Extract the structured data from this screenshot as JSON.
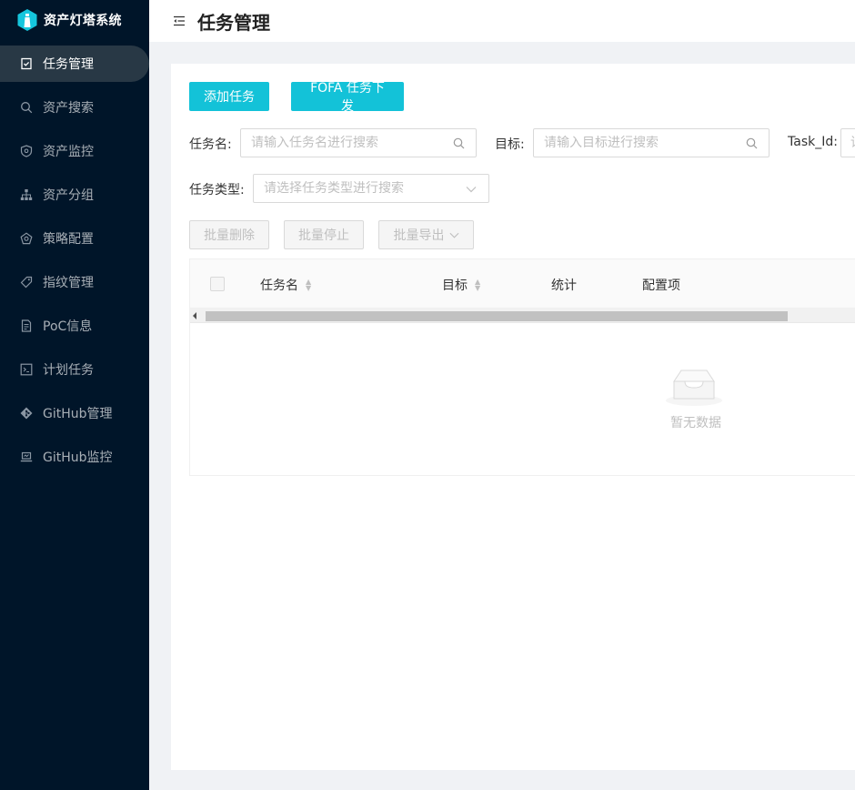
{
  "app": {
    "title": "资产灯塔系统"
  },
  "sidebar": {
    "items": [
      {
        "label": "任务管理",
        "icon": "task-icon",
        "active": true
      },
      {
        "label": "资产搜索",
        "icon": "search-icon"
      },
      {
        "label": "资产监控",
        "icon": "monitor-icon"
      },
      {
        "label": "资产分组",
        "icon": "group-icon"
      },
      {
        "label": "策略配置",
        "icon": "policy-icon"
      },
      {
        "label": "指纹管理",
        "icon": "tag-icon"
      },
      {
        "label": "PoC信息",
        "icon": "file-icon"
      },
      {
        "label": "计划任务",
        "icon": "code-icon"
      },
      {
        "label": "GitHub管理",
        "icon": "github-icon"
      },
      {
        "label": "GitHub监控",
        "icon": "laptop-icon"
      }
    ]
  },
  "header": {
    "title": "任务管理"
  },
  "toolbar": {
    "add_label": "添加任务",
    "fofa_label": "FOFA 任务下发"
  },
  "filters": {
    "task_name_label": "任务名:",
    "task_name_placeholder": "请输入任务名进行搜索",
    "target_label": "目标:",
    "target_placeholder": "请输入目标进行搜索",
    "task_id_label": "Task_Id:",
    "task_id_placeholder": "请",
    "task_type_label": "任务类型:",
    "task_type_placeholder": "请选择任务类型进行搜索"
  },
  "batch": {
    "delete_label": "批量删除",
    "stop_label": "批量停止",
    "export_label": "批量导出"
  },
  "table": {
    "columns": [
      "任务名",
      "目标",
      "统计",
      "配置项"
    ],
    "empty_text": "暂无数据"
  },
  "colors": {
    "sidebar_bg": "#001529",
    "active_item_bg": "#283845",
    "primary": "#13c2d8"
  }
}
